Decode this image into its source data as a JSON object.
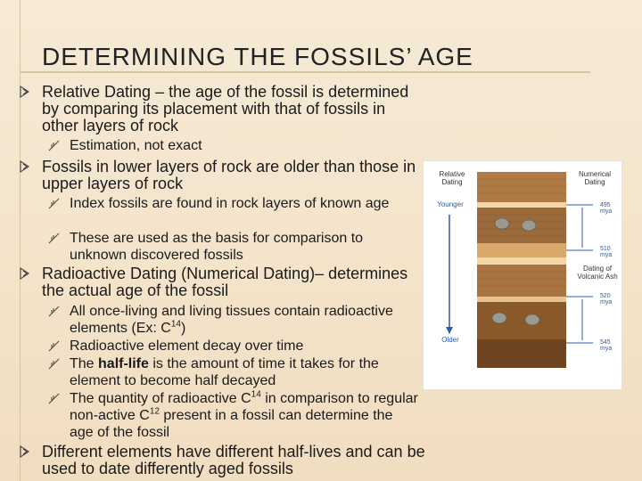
{
  "slide": {
    "title": "DETERMINING THE FOSSILS’ AGE"
  },
  "bullets": [
    {
      "text": "Relative Dating – the age of the fossil is determined by comparing its placement with that of fossils in other layers of rock",
      "subs": [
        "Estimation, not exact"
      ]
    },
    {
      "text": "Fossils in lower layers of rock are older than those in upper layers of rock",
      "subs": [
        "Index fossils are found in rock layers of known age",
        "These are used as the basis for comparison to unknown discovered fossils"
      ]
    },
    {
      "text": "Radioactive Dating  (Numerical Dating)– determines the actual age of the fossil",
      "subs": [
        {
          "pre": "All once-living and living tissues contain radioactive elements (Ex: C",
          "sup": "14",
          "post": ")"
        },
        "Radioactive element decay over time",
        {
          "pre": "The ",
          "bold": "half-life",
          "post": " is the amount of time it takes for the element to become half decayed"
        },
        {
          "pre": "The quantity of radioactive C",
          "sup": "14",
          "mid": " in comparison to regular non-active C",
          "sup2": "12",
          "post": " present in a fossil can determine the age of the fossil"
        }
      ]
    },
    {
      "text": "Different elements have different half-lives and can be used to date differently aged fossils",
      "subs": []
    }
  ],
  "figure": {
    "relative_label": "Relative Dating",
    "numerical_label": "Numerical Dating",
    "younger_label": "Younger",
    "older_label": "Older",
    "ash_label": "Dating of Volcanic Ash",
    "ticks": [
      "495 mya",
      "510 mya",
      "520 mya",
      "545 mya"
    ],
    "colors": {
      "arrow": "#2a5da8",
      "rock_light": "#d8a86b",
      "rock_dark": "#8a5a2b",
      "ash": "#f2d6a8"
    }
  }
}
